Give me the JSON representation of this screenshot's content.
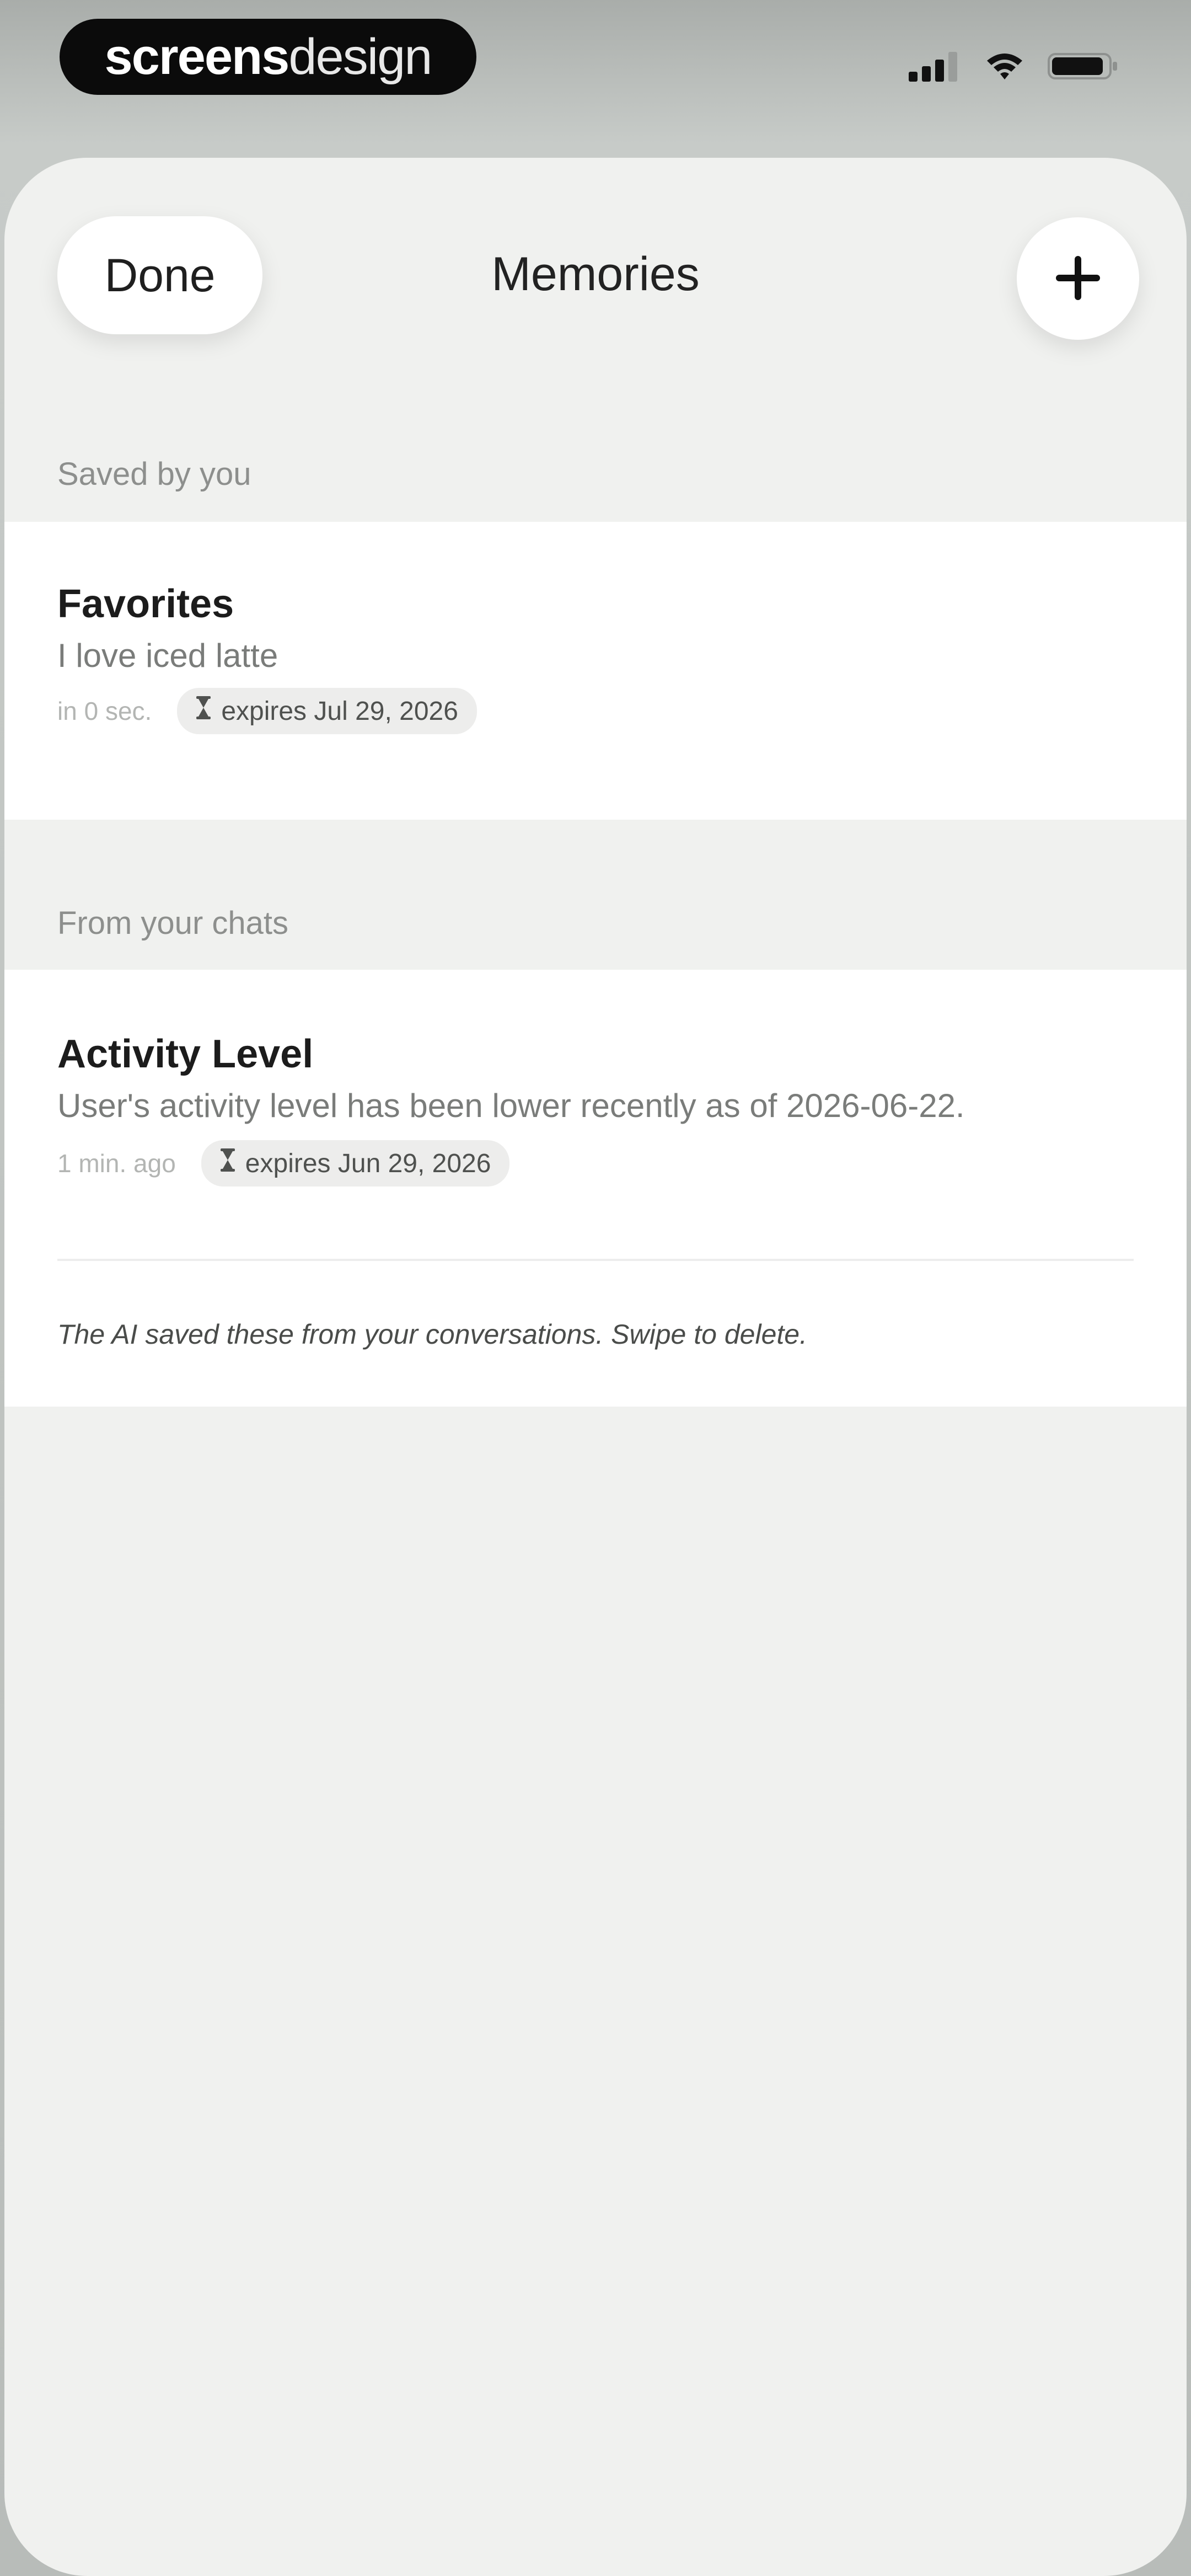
{
  "status_bar": {
    "brand_bold": "screens",
    "brand_light": "design",
    "icons": [
      "cellular-signal-icon",
      "wifi-icon",
      "battery-icon"
    ]
  },
  "header": {
    "done_label": "Done",
    "title": "Memories",
    "add_icon": "plus-icon"
  },
  "sections": [
    {
      "header": "Saved by you",
      "items": [
        {
          "title": "Favorites",
          "text": "I love iced latte",
          "time": "in 0 sec.",
          "expiry": "expires Jul 29, 2026"
        }
      ]
    },
    {
      "header": "From your chats",
      "items": [
        {
          "title": "Activity Level",
          "text": "User's activity level has been lower recently as of 2026-06-22.",
          "time": "1 min. ago",
          "expiry": "expires Jun 29, 2026"
        }
      ],
      "footer": "The AI saved these from your conversations. Swipe to delete."
    }
  ],
  "colors": {
    "sheet_background": "#f0f1ef",
    "card_background": "#ffffff",
    "brand_pill": "#0b0b0b"
  }
}
